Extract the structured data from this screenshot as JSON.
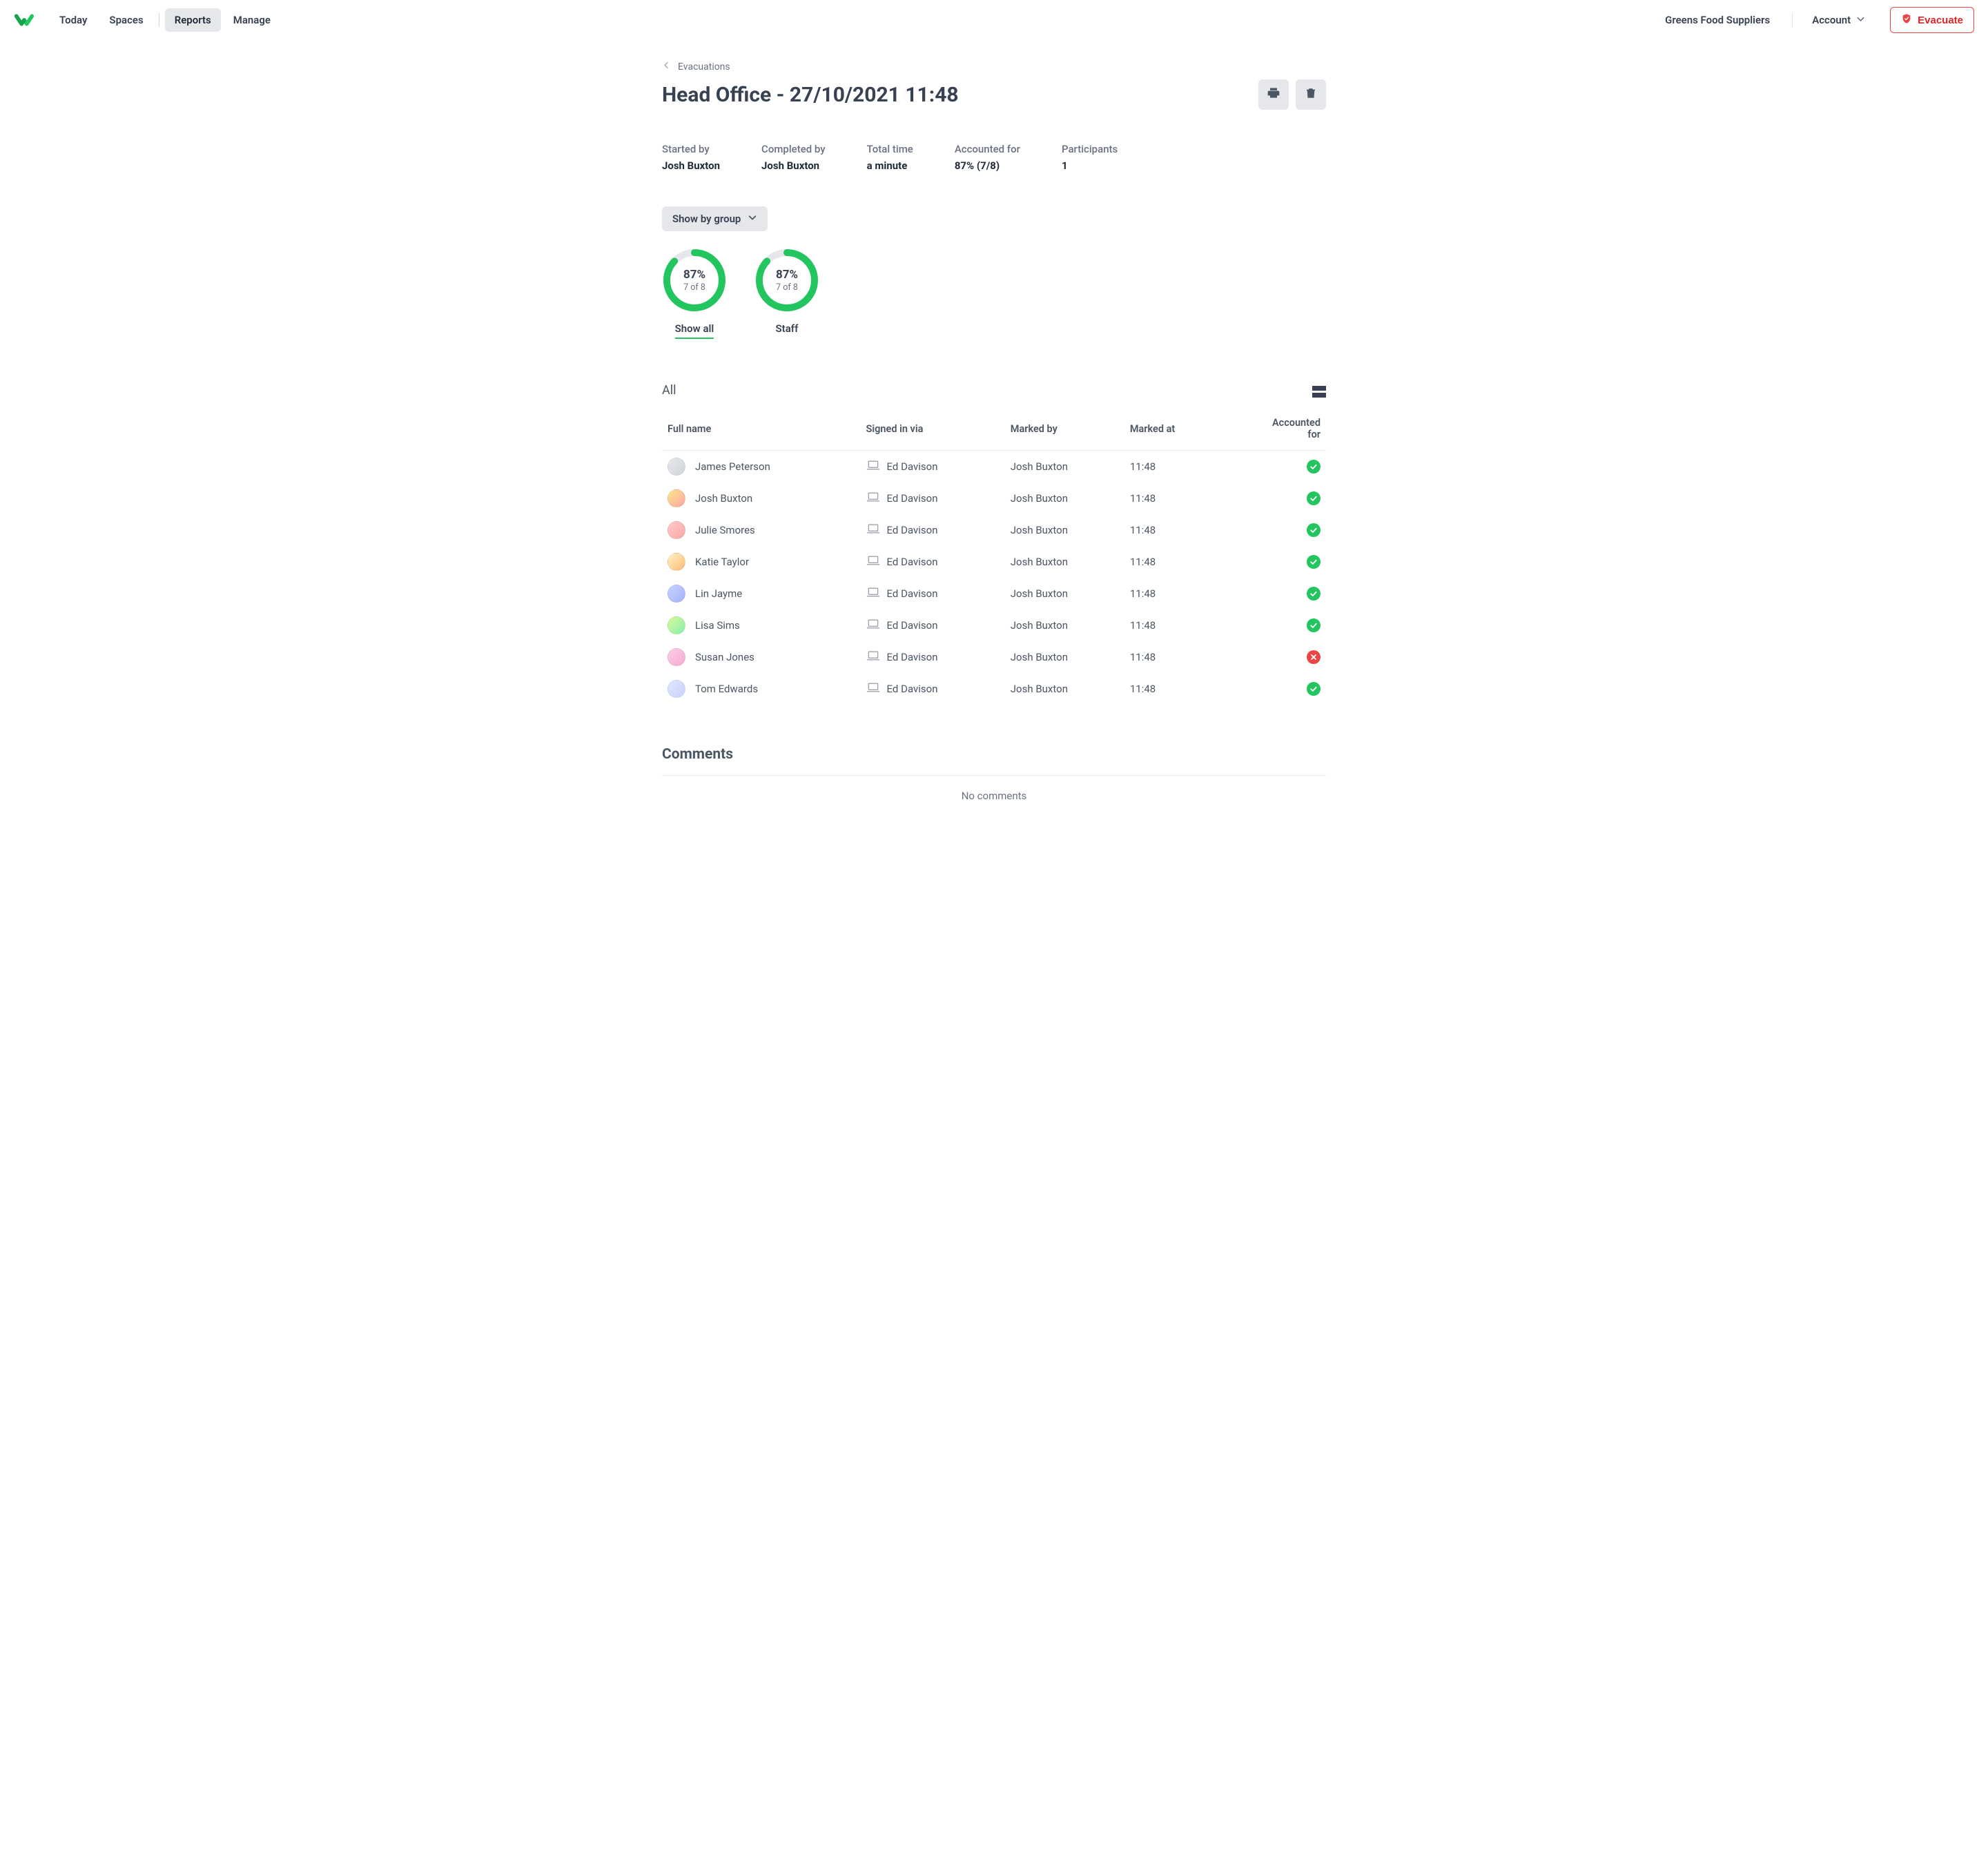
{
  "nav": {
    "items": [
      "Today",
      "Spaces",
      "Reports",
      "Manage"
    ],
    "active_index": 2,
    "org": "Greens Food Suppliers",
    "account_label": "Account",
    "evacuate_label": "Evacuate"
  },
  "breadcrumb": {
    "label": "Evacuations"
  },
  "page_title": "Head Office - 27/10/2021 11:48",
  "meta": {
    "started_by": {
      "label": "Started by",
      "value": "Josh Buxton"
    },
    "completed_by": {
      "label": "Completed by",
      "value": "Josh Buxton"
    },
    "total_time": {
      "label": "Total time",
      "value": "a minute"
    },
    "accounted_for": {
      "label": "Accounted for",
      "value": "87% (7/8)"
    },
    "participants": {
      "label": "Participants",
      "value": "1"
    }
  },
  "filter": {
    "label": "Show by group"
  },
  "chart_data": [
    {
      "type": "donut",
      "label": "Show all",
      "percent": 87,
      "count_text": "7 of 8",
      "active": true
    },
    {
      "type": "donut",
      "label": "Staff",
      "percent": 87,
      "count_text": "7 of 8",
      "active": false
    }
  ],
  "table": {
    "section_label": "All",
    "columns": [
      "Full name",
      "Signed in via",
      "Marked by",
      "Marked at",
      "Accounted for"
    ],
    "rows": [
      {
        "name": "James Peterson",
        "signed_via": "Ed Davison",
        "marked_by": "Josh Buxton",
        "marked_at": "11:48",
        "accounted": true
      },
      {
        "name": "Josh Buxton",
        "signed_via": "Ed Davison",
        "marked_by": "Josh Buxton",
        "marked_at": "11:48",
        "accounted": true
      },
      {
        "name": "Julie Smores",
        "signed_via": "Ed Davison",
        "marked_by": "Josh Buxton",
        "marked_at": "11:48",
        "accounted": true
      },
      {
        "name": "Katie Taylor",
        "signed_via": "Ed Davison",
        "marked_by": "Josh Buxton",
        "marked_at": "11:48",
        "accounted": true
      },
      {
        "name": "Lin Jayme",
        "signed_via": "Ed Davison",
        "marked_by": "Josh Buxton",
        "marked_at": "11:48",
        "accounted": true
      },
      {
        "name": "Lisa Sims",
        "signed_via": "Ed Davison",
        "marked_by": "Josh Buxton",
        "marked_at": "11:48",
        "accounted": true
      },
      {
        "name": "Susan Jones",
        "signed_via": "Ed Davison",
        "marked_by": "Josh Buxton",
        "marked_at": "11:48",
        "accounted": false
      },
      {
        "name": "Tom Edwards",
        "signed_via": "Ed Davison",
        "marked_by": "Josh Buxton",
        "marked_at": "11:48",
        "accounted": true
      }
    ]
  },
  "comments": {
    "heading": "Comments",
    "empty_text": "No comments"
  },
  "avatar_colors": [
    "linear-gradient(135deg,#e5e7eb,#d1d5db)",
    "linear-gradient(135deg,#fde68a,#fca5a5)",
    "linear-gradient(135deg,#fecaca,#fca5a5)",
    "linear-gradient(135deg,#fef3c7,#fdba74)",
    "linear-gradient(135deg,#c7d2fe,#a5b4fc)",
    "linear-gradient(135deg,#d9f99d,#86efac)",
    "linear-gradient(135deg,#fbcfe8,#f9a8d4)",
    "linear-gradient(135deg,#e0e7ff,#c7d2fe)"
  ]
}
